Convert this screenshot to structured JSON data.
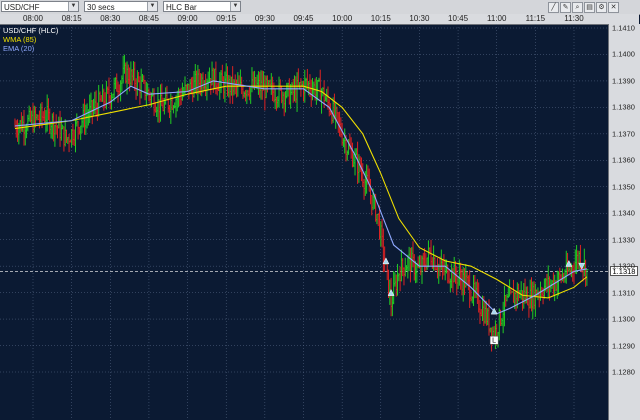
{
  "toolbar": {
    "symbol": "USD/CHF",
    "interval": "30 secs",
    "chart_style": "HLC Bar",
    "tool_icons": [
      "draw-line-icon",
      "draw-pencil-icon",
      "zoom-icon",
      "print-icon",
      "settings-icon",
      "close-icon"
    ]
  },
  "legend": {
    "instrument": "USD/CHF (HLC)",
    "wma": "WMA (85)",
    "ema": "EMA (20)",
    "colors": {
      "instrument": "#ffffff",
      "wma": "#f0e000",
      "ema": "#8fa8ff"
    }
  },
  "current_price_label": "1.1318",
  "low_marker_label": "L",
  "colors": {
    "background": "#0b1a33",
    "grid": "#5a6b8a",
    "up": "#22cc22",
    "down": "#dd2222",
    "wma": "#f0e000",
    "ema": "#8fa8ff"
  },
  "chart_data": {
    "type": "hlc-bar",
    "instrument": "USD/CHF",
    "x_ticks": [
      "08:00",
      "08:15",
      "08:30",
      "08:45",
      "09:00",
      "09:15",
      "09:30",
      "09:45",
      "10:00",
      "10:15",
      "10:30",
      "10:45",
      "11:00",
      "11:15",
      "11:30"
    ],
    "y_ticks": [
      "1.1410",
      "1.1400",
      "1.1390",
      "1.1380",
      "1.1370",
      "1.1360",
      "1.1350",
      "1.1340",
      "1.1330",
      "1.1320",
      "1.1310",
      "1.1300",
      "1.1290",
      "1.1280"
    ],
    "ylim": [
      1.1276,
      1.1414
    ],
    "current_price": 1.1318,
    "price_path": [
      [
        "07:53",
        1.1373
      ],
      [
        "08:00",
        1.1375
      ],
      [
        "08:05",
        1.1377
      ],
      [
        "08:10",
        1.1372
      ],
      [
        "08:13",
        1.1368
      ],
      [
        "08:18",
        1.1374
      ],
      [
        "08:24",
        1.138
      ],
      [
        "08:30",
        1.1385
      ],
      [
        "08:36",
        1.1393
      ],
      [
        "08:40",
        1.139
      ],
      [
        "08:45",
        1.1385
      ],
      [
        "08:50",
        1.138
      ],
      [
        "08:56",
        1.1384
      ],
      [
        "09:02",
        1.1388
      ],
      [
        "09:08",
        1.1392
      ],
      [
        "09:13",
        1.1389
      ],
      [
        "09:20",
        1.1387
      ],
      [
        "09:27",
        1.1388
      ],
      [
        "09:33",
        1.1386
      ],
      [
        "09:40",
        1.1385
      ],
      [
        "09:46",
        1.1389
      ],
      [
        "09:52",
        1.1386
      ],
      [
        "09:57",
        1.1377
      ],
      [
        "10:02",
        1.1365
      ],
      [
        "10:07",
        1.1357
      ],
      [
        "10:11",
        1.1347
      ],
      [
        "10:14",
        1.1338
      ],
      [
        "10:17",
        1.1318
      ],
      [
        "10:19",
        1.1306
      ],
      [
        "10:22",
        1.1318
      ],
      [
        "10:26",
        1.1322
      ],
      [
        "10:30",
        1.1318
      ],
      [
        "10:34",
        1.1325
      ],
      [
        "10:38",
        1.1319
      ],
      [
        "10:43",
        1.1317
      ],
      [
        "10:48",
        1.1314
      ],
      [
        "10:52",
        1.1308
      ],
      [
        "10:56",
        1.1301
      ],
      [
        "10:59",
        1.1294
      ],
      [
        "11:03",
        1.1305
      ],
      [
        "11:08",
        1.131
      ],
      [
        "11:13",
        1.1308
      ],
      [
        "11:18",
        1.1312
      ],
      [
        "11:23",
        1.1314
      ],
      [
        "11:28",
        1.1318
      ],
      [
        "11:32",
        1.1324
      ],
      [
        "11:35",
        1.1318
      ]
    ],
    "wma_85": [
      [
        "07:53",
        1.1372
      ],
      [
        "08:15",
        1.1375
      ],
      [
        "08:30",
        1.1378
      ],
      [
        "08:45",
        1.1381
      ],
      [
        "09:00",
        1.1385
      ],
      [
        "09:15",
        1.1388
      ],
      [
        "09:30",
        1.1388
      ],
      [
        "09:45",
        1.1388
      ],
      [
        "09:52",
        1.1386
      ],
      [
        "10:00",
        1.138
      ],
      [
        "10:08",
        1.137
      ],
      [
        "10:15",
        1.1355
      ],
      [
        "10:22",
        1.1338
      ],
      [
        "10:30",
        1.1327
      ],
      [
        "10:40",
        1.1322
      ],
      [
        "10:50",
        1.132
      ],
      [
        "11:00",
        1.1315
      ],
      [
        "11:10",
        1.1309
      ],
      [
        "11:20",
        1.1308
      ],
      [
        "11:30",
        1.1312
      ],
      [
        "11:35",
        1.1316
      ]
    ],
    "ema_20": [
      [
        "07:53",
        1.1373
      ],
      [
        "08:15",
        1.1375
      ],
      [
        "08:30",
        1.1382
      ],
      [
        "08:38",
        1.1388
      ],
      [
        "08:45",
        1.1385
      ],
      [
        "09:00",
        1.1386
      ],
      [
        "09:10",
        1.139
      ],
      [
        "09:30",
        1.1387
      ],
      [
        "09:45",
        1.1387
      ],
      [
        "09:55",
        1.138
      ],
      [
        "10:05",
        1.1362
      ],
      [
        "10:12",
        1.1348
      ],
      [
        "10:20",
        1.1328
      ],
      [
        "10:30",
        1.132
      ],
      [
        "10:40",
        1.132
      ],
      [
        "10:50",
        1.1312
      ],
      [
        "11:00",
        1.1302
      ],
      [
        "11:05",
        1.1304
      ],
      [
        "11:15",
        1.1309
      ],
      [
        "11:30",
        1.1318
      ],
      [
        "11:35",
        1.1319
      ]
    ],
    "signal_arrows": [
      {
        "time": "10:17",
        "price": 1.1322,
        "direction": "up"
      },
      {
        "time": "10:19",
        "price": 1.131,
        "direction": "up"
      },
      {
        "time": "10:59",
        "price": 1.1303,
        "direction": "up"
      },
      {
        "time": "11:28",
        "price": 1.1321,
        "direction": "up"
      },
      {
        "time": "11:33",
        "price": 1.132,
        "direction": "down"
      }
    ],
    "grid": true
  }
}
